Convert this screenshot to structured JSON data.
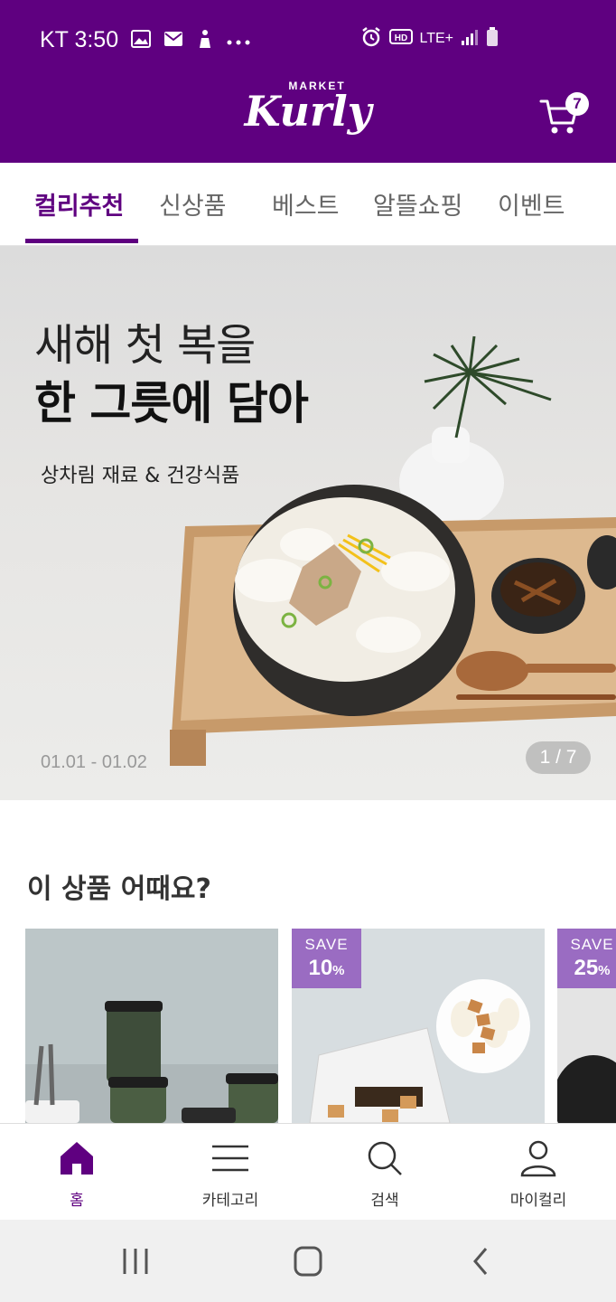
{
  "status_bar": {
    "carrier_time": "KT 3:50",
    "network": "LTE+",
    "icons": [
      "gallery-icon",
      "mail-icon",
      "accessibility-icon",
      "more-icon",
      "alarm-icon",
      "hd-icon",
      "signal-icon",
      "battery-icon"
    ]
  },
  "header": {
    "logo_small": "MARKET",
    "logo_main": "Kurly",
    "cart_count": "7",
    "brand_color": "#5f0080"
  },
  "tabs": [
    {
      "label": "컬리추천",
      "active": true
    },
    {
      "label": "신상품",
      "active": false
    },
    {
      "label": "베스트",
      "active": false
    },
    {
      "label": "알뜰쇼핑",
      "active": false
    },
    {
      "label": "이벤트",
      "active": false
    }
  ],
  "banner": {
    "line1": "새해 첫 복을",
    "line2": "한 그릇에 담아",
    "subtitle": "상차림 재료 & 건강식품",
    "date_range": "01.01 - 01.02",
    "pager": "1 / 7"
  },
  "recommend": {
    "title": "이 상품 어때요?",
    "cards": [
      {
        "save_label": "",
        "save_value": ""
      },
      {
        "save_label": "SAVE",
        "save_value": "10",
        "save_unit": "%"
      },
      {
        "save_label": "SAVE",
        "save_value": "25",
        "save_unit": "%"
      }
    ],
    "save_color": "#9a6cc2"
  },
  "bottom_nav": [
    {
      "label": "홈",
      "icon": "home-icon",
      "active": true
    },
    {
      "label": "카테고리",
      "icon": "menu-icon",
      "active": false
    },
    {
      "label": "검색",
      "icon": "search-icon",
      "active": false
    },
    {
      "label": "마이컬리",
      "icon": "user-icon",
      "active": false
    }
  ]
}
